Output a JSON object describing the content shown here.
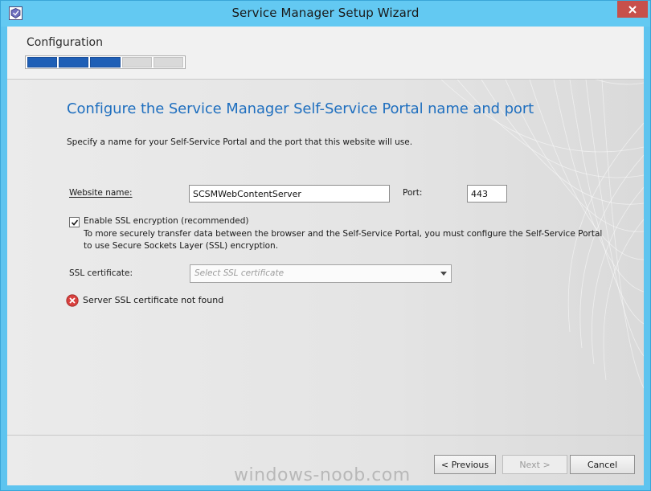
{
  "window": {
    "title": "Service Manager Setup Wizard"
  },
  "header": {
    "section_title": "Configuration",
    "progress": {
      "total_steps": 5,
      "completed_steps": 3
    }
  },
  "content": {
    "heading": "Configure the Service Manager Self-Service Portal name and port",
    "instructions": "Specify a name for your Self-Service Portal and the port that this website will use.",
    "website_name_label": "Website name:",
    "website_name_value": "SCSMWebContentServer",
    "port_label": "Port:",
    "port_value": "443",
    "ssl_checkbox": {
      "label": "Enable SSL encryption (recommended)",
      "checked": true
    },
    "ssl_description": "To more securely transfer data between the browser and the Self-Service Portal, you must configure the Self-Service Portal to use Secure Sockets Layer (SSL) encryption.",
    "ssl_certificate_label": "SSL certificate:",
    "ssl_certificate_placeholder": "Select SSL certificate",
    "error_message": "Server SSL certificate not found"
  },
  "buttons": {
    "previous": "< Previous",
    "next": "Next >",
    "cancel": "Cancel"
  },
  "watermark": "windows-noob.com",
  "colors": {
    "titlebar": "#63c9f2",
    "heading": "#1f6fbf",
    "progress_done": "#1f5fb6",
    "close_button": "#c7504b",
    "error": "#d9413f"
  }
}
